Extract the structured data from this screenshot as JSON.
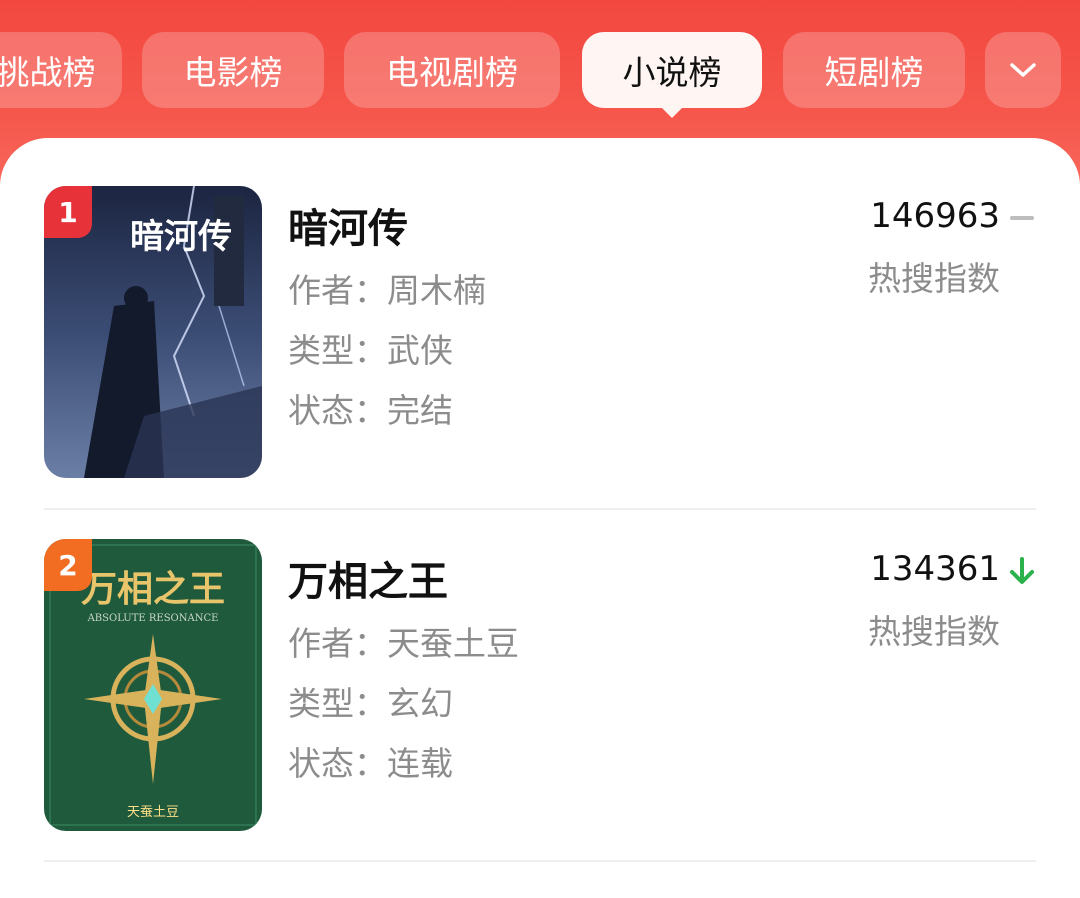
{
  "tabs": [
    {
      "label": "挑战榜",
      "active": false
    },
    {
      "label": "电影榜",
      "active": false
    },
    {
      "label": "电视剧榜",
      "active": false
    },
    {
      "label": "小说榜",
      "active": true
    },
    {
      "label": "短剧榜",
      "active": false
    }
  ],
  "more_icon": "chevron-down-icon",
  "items": [
    {
      "rank": "1",
      "title": "暗河传",
      "author_label": "作者：",
      "author": "周木楠",
      "genre_label": "类型：",
      "genre": "武侠",
      "status_label": "状态：",
      "status": "完结",
      "score": "146963",
      "trend": "flat",
      "hot_label": "热搜指数",
      "cover_title": "暗河传",
      "badge_color": "#e8323a"
    },
    {
      "rank": "2",
      "title": "万相之王",
      "author_label": "作者：",
      "author": "天蚕土豆",
      "genre_label": "类型：",
      "genre": "玄幻",
      "status_label": "状态：",
      "status": "连载",
      "score": "134361",
      "trend": "down",
      "hot_label": "热搜指数",
      "cover_title": "万相之王",
      "cover_subtitle": "ABSOLUTE RESONANCE",
      "cover_author": "天蚕土豆",
      "badge_color": "#f26c22"
    }
  ],
  "colors": {
    "accent": "#f2473f",
    "trend_down": "#2bb24c",
    "trend_flat": "#bdbdbd"
  }
}
